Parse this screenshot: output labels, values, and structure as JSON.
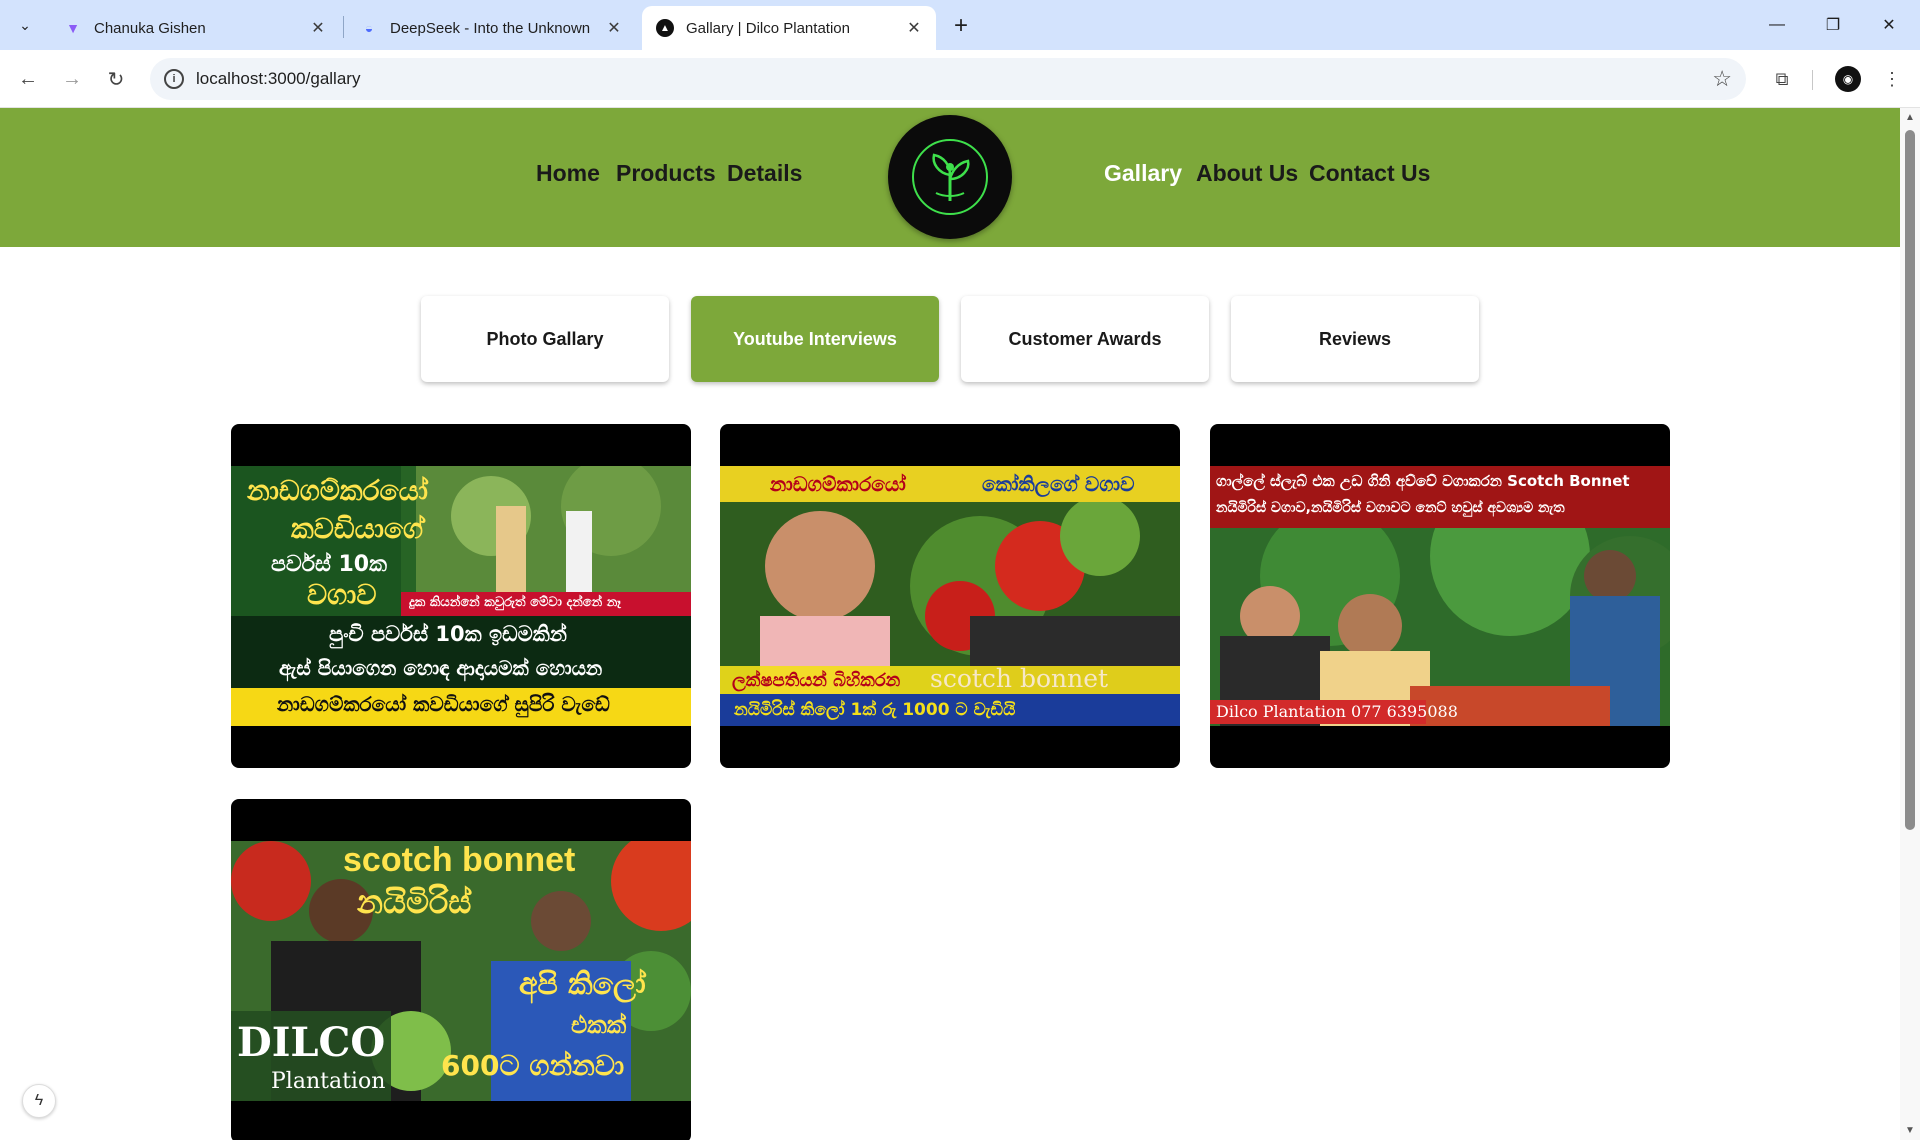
{
  "browser": {
    "tabs": [
      {
        "title": "Chanuka Gishen",
        "favicon": "vite-icon"
      },
      {
        "title": "DeepSeek - Into the Unknown",
        "favicon": "deepseek-icon"
      },
      {
        "title": "Gallary | Dilco Plantation",
        "favicon": "nextjs-icon"
      }
    ],
    "url": "localhost:3000/gallary"
  },
  "header": {
    "nav_left": [
      "Home",
      "Products",
      "Details"
    ],
    "nav_right": [
      "Gallary",
      "About Us",
      "Contact Us"
    ],
    "active_nav": "Gallary"
  },
  "gallery_tabs": {
    "items": [
      "Photo Gallary",
      "Youtube Interviews",
      "Customer Awards",
      "Reviews"
    ],
    "active": "Youtube Interviews"
  },
  "videos": [
    {
      "lines": [
        "නාඩගම්කරයෝ",
        "කවඩියාගේ",
        "පර්වස් 10ක",
        "වගාව",
        "දුක කියන්නේ කවුරුත් මේවා දන්නේ නෑ",
        "පුංචි පර්වස් 10ක ඉඩමකින්",
        "ඇස් පියාගෙන හොඳ ආදායමක් හොයන",
        "නාඩගම්කරයෝ කවඩියාගේ සුපිරි වැඩේ"
      ]
    },
    {
      "lines": [
        "නාඩගම්කාරයෝ",
        "කෝකිලගේ වගාව",
        "ලක්ෂපතියන් බිහිකරන",
        "scotch bonnet",
        "නයිමිරිස් කිලෝ 1ක් රු 1000 ට වැඩියි"
      ]
    },
    {
      "lines": [
        "ගාල්ලේ ස්ලැබ් එක උඩ ගිනි අව්වේ වගාකරන Scotch Bonnet",
        "නයිමිරිස් වගාව,නයිමිරිස් වගාවට නෙට් හවුස් අවශ්‍යම නැත",
        "Dilco Plantation  077 6395088"
      ]
    },
    {
      "lines": [
        "scotch bonnet",
        "නයිමිරිස්",
        "අපි කිලෝ",
        "එකක්",
        "600ට ගන්නවා",
        "DILCO",
        "Plantation"
      ]
    }
  ],
  "colors": {
    "brand_green": "#7da83a",
    "logo_green": "#3ee04b",
    "chrome_tabbar": "#d3e3fd"
  }
}
